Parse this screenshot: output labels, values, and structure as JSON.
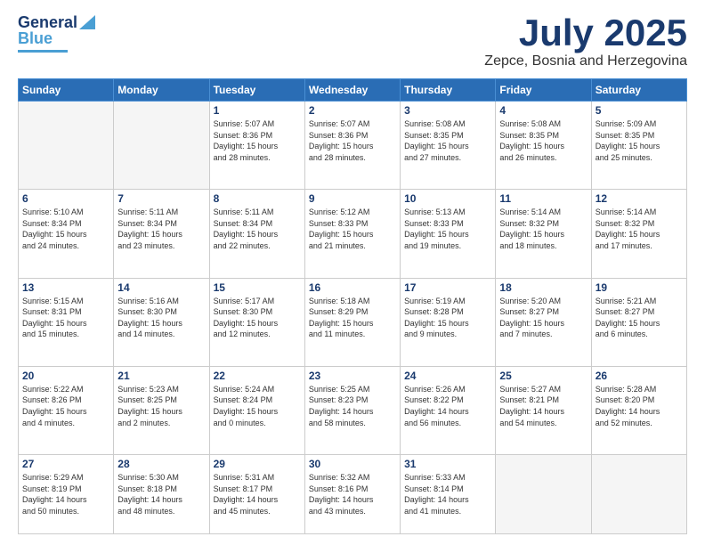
{
  "header": {
    "logo": {
      "line1": "General",
      "line2": "Blue"
    },
    "title": "July 2025",
    "location": "Zepce, Bosnia and Herzegovina"
  },
  "days_of_week": [
    "Sunday",
    "Monday",
    "Tuesday",
    "Wednesday",
    "Thursday",
    "Friday",
    "Saturday"
  ],
  "weeks": [
    [
      {
        "day": "",
        "info": ""
      },
      {
        "day": "",
        "info": ""
      },
      {
        "day": "1",
        "info": "Sunrise: 5:07 AM\nSunset: 8:36 PM\nDaylight: 15 hours\nand 28 minutes."
      },
      {
        "day": "2",
        "info": "Sunrise: 5:07 AM\nSunset: 8:36 PM\nDaylight: 15 hours\nand 28 minutes."
      },
      {
        "day": "3",
        "info": "Sunrise: 5:08 AM\nSunset: 8:35 PM\nDaylight: 15 hours\nand 27 minutes."
      },
      {
        "day": "4",
        "info": "Sunrise: 5:08 AM\nSunset: 8:35 PM\nDaylight: 15 hours\nand 26 minutes."
      },
      {
        "day": "5",
        "info": "Sunrise: 5:09 AM\nSunset: 8:35 PM\nDaylight: 15 hours\nand 25 minutes."
      }
    ],
    [
      {
        "day": "6",
        "info": "Sunrise: 5:10 AM\nSunset: 8:34 PM\nDaylight: 15 hours\nand 24 minutes."
      },
      {
        "day": "7",
        "info": "Sunrise: 5:11 AM\nSunset: 8:34 PM\nDaylight: 15 hours\nand 23 minutes."
      },
      {
        "day": "8",
        "info": "Sunrise: 5:11 AM\nSunset: 8:34 PM\nDaylight: 15 hours\nand 22 minutes."
      },
      {
        "day": "9",
        "info": "Sunrise: 5:12 AM\nSunset: 8:33 PM\nDaylight: 15 hours\nand 21 minutes."
      },
      {
        "day": "10",
        "info": "Sunrise: 5:13 AM\nSunset: 8:33 PM\nDaylight: 15 hours\nand 19 minutes."
      },
      {
        "day": "11",
        "info": "Sunrise: 5:14 AM\nSunset: 8:32 PM\nDaylight: 15 hours\nand 18 minutes."
      },
      {
        "day": "12",
        "info": "Sunrise: 5:14 AM\nSunset: 8:32 PM\nDaylight: 15 hours\nand 17 minutes."
      }
    ],
    [
      {
        "day": "13",
        "info": "Sunrise: 5:15 AM\nSunset: 8:31 PM\nDaylight: 15 hours\nand 15 minutes."
      },
      {
        "day": "14",
        "info": "Sunrise: 5:16 AM\nSunset: 8:30 PM\nDaylight: 15 hours\nand 14 minutes."
      },
      {
        "day": "15",
        "info": "Sunrise: 5:17 AM\nSunset: 8:30 PM\nDaylight: 15 hours\nand 12 minutes."
      },
      {
        "day": "16",
        "info": "Sunrise: 5:18 AM\nSunset: 8:29 PM\nDaylight: 15 hours\nand 11 minutes."
      },
      {
        "day": "17",
        "info": "Sunrise: 5:19 AM\nSunset: 8:28 PM\nDaylight: 15 hours\nand 9 minutes."
      },
      {
        "day": "18",
        "info": "Sunrise: 5:20 AM\nSunset: 8:27 PM\nDaylight: 15 hours\nand 7 minutes."
      },
      {
        "day": "19",
        "info": "Sunrise: 5:21 AM\nSunset: 8:27 PM\nDaylight: 15 hours\nand 6 minutes."
      }
    ],
    [
      {
        "day": "20",
        "info": "Sunrise: 5:22 AM\nSunset: 8:26 PM\nDaylight: 15 hours\nand 4 minutes."
      },
      {
        "day": "21",
        "info": "Sunrise: 5:23 AM\nSunset: 8:25 PM\nDaylight: 15 hours\nand 2 minutes."
      },
      {
        "day": "22",
        "info": "Sunrise: 5:24 AM\nSunset: 8:24 PM\nDaylight: 15 hours\nand 0 minutes."
      },
      {
        "day": "23",
        "info": "Sunrise: 5:25 AM\nSunset: 8:23 PM\nDaylight: 14 hours\nand 58 minutes."
      },
      {
        "day": "24",
        "info": "Sunrise: 5:26 AM\nSunset: 8:22 PM\nDaylight: 14 hours\nand 56 minutes."
      },
      {
        "day": "25",
        "info": "Sunrise: 5:27 AM\nSunset: 8:21 PM\nDaylight: 14 hours\nand 54 minutes."
      },
      {
        "day": "26",
        "info": "Sunrise: 5:28 AM\nSunset: 8:20 PM\nDaylight: 14 hours\nand 52 minutes."
      }
    ],
    [
      {
        "day": "27",
        "info": "Sunrise: 5:29 AM\nSunset: 8:19 PM\nDaylight: 14 hours\nand 50 minutes."
      },
      {
        "day": "28",
        "info": "Sunrise: 5:30 AM\nSunset: 8:18 PM\nDaylight: 14 hours\nand 48 minutes."
      },
      {
        "day": "29",
        "info": "Sunrise: 5:31 AM\nSunset: 8:17 PM\nDaylight: 14 hours\nand 45 minutes."
      },
      {
        "day": "30",
        "info": "Sunrise: 5:32 AM\nSunset: 8:16 PM\nDaylight: 14 hours\nand 43 minutes."
      },
      {
        "day": "31",
        "info": "Sunrise: 5:33 AM\nSunset: 8:14 PM\nDaylight: 14 hours\nand 41 minutes."
      },
      {
        "day": "",
        "info": ""
      },
      {
        "day": "",
        "info": ""
      }
    ]
  ]
}
